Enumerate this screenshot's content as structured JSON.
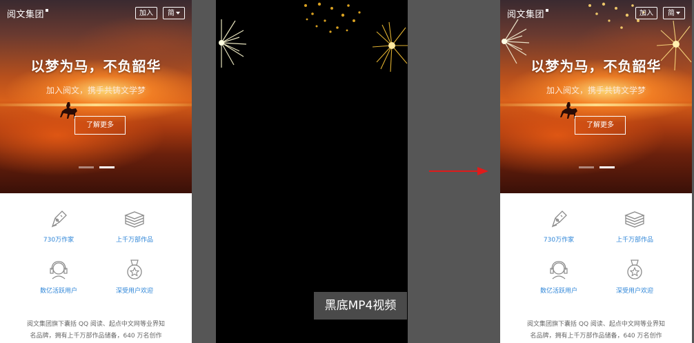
{
  "phone": {
    "brand": "阅文集团",
    "join_button": "加入",
    "lang_button": "简",
    "hero_title": "以梦为马，不负韶华",
    "hero_subtitle": "加入阅文，携手共铸文学梦",
    "hero_cta": "了解更多",
    "features": [
      {
        "label": "730万作家",
        "icon": "pen-nib-icon"
      },
      {
        "label": "上千万部作品",
        "icon": "book-stack-icon"
      },
      {
        "label": "数亿活跃用户",
        "icon": "user-headphones-icon"
      },
      {
        "label": "深受用户欢迎",
        "icon": "medal-icon"
      }
    ],
    "intro_line1": "阅文集团旗下囊括 QQ 阅读、起点中文网等业界知",
    "intro_line2": "名品牌，拥有上千万部作品储备，640 万名创作"
  },
  "video": {
    "label": "黑底MP4视频"
  },
  "colors": {
    "page_bg": "#565656",
    "feature_label": "#2f86d8",
    "arrow": "#e01b1b",
    "video_bg": "#000000",
    "label_bg": "#4a4a4a"
  }
}
